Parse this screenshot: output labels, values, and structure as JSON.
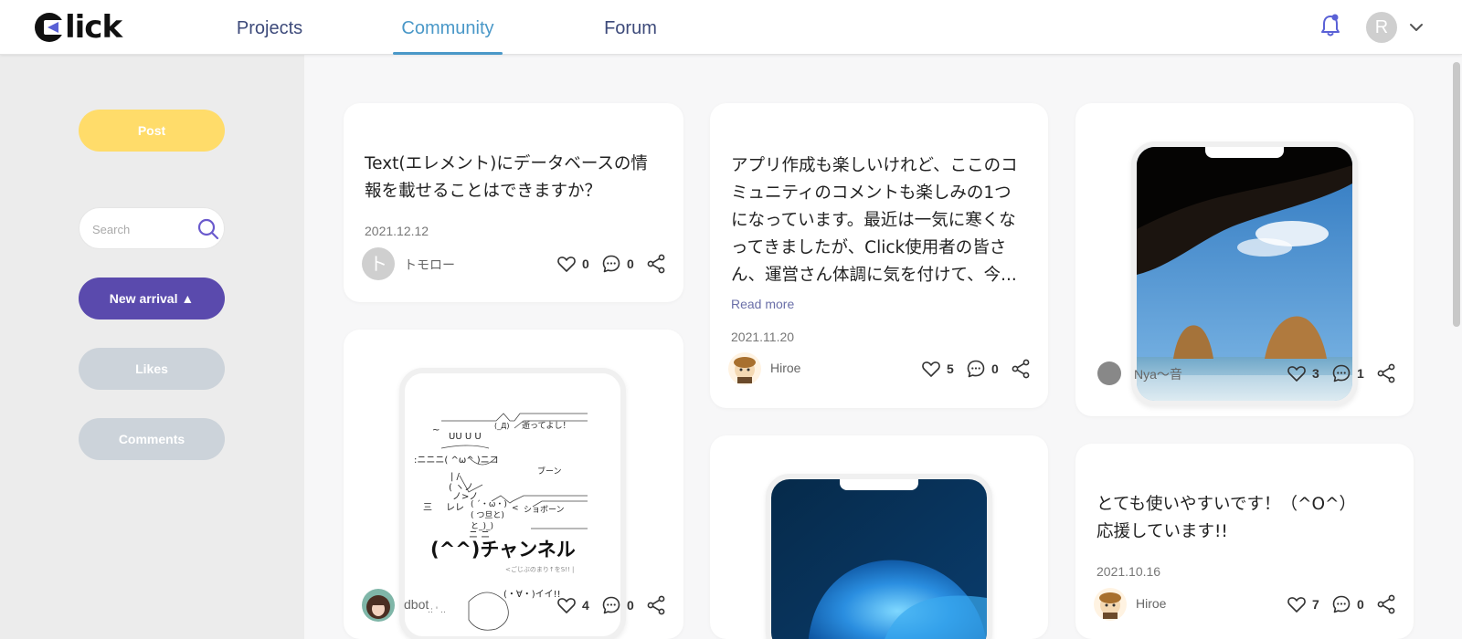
{
  "header": {
    "logo_text": "lick",
    "tabs": [
      {
        "label": "Projects"
      },
      {
        "label": "Community"
      },
      {
        "label": "Forum"
      }
    ],
    "avatar_initial": "R"
  },
  "sidebar": {
    "post_label": "Post",
    "search_placeholder": "Search",
    "new_arrival_label": "New arrival ▲",
    "likes_label": "Likes",
    "comments_label": "Comments"
  },
  "posts": [
    {
      "text_line1": "Text(エレメント)にデータベースの情",
      "text_line2": "報を載せることはできますか？",
      "date": "2021.12.12",
      "user": "トモロー",
      "avatar_initial": "ト",
      "likes": "0",
      "comments": "0"
    },
    {
      "image_title": "(^^)チャンネル",
      "user": "dbot",
      "likes": "4",
      "comments": "0"
    },
    {
      "text_line1": "アプリ作成も楽しいけれど、ここのコ",
      "text_line2": "ミュニティのコメントも楽しみの1つ",
      "text_line3": "になっています。最近は一気に寒くな",
      "text_line4": "ってきましたが、Click使用者の皆さ",
      "text_line5": "ん、運営さん体調に気を付けて、今...",
      "read_more": "Read more",
      "date": "2021.11.20",
      "user": "Hiroe",
      "likes": "5",
      "comments": "0"
    },
    {
      "user": "Nya～音",
      "likes": "3",
      "comments": "1"
    },
    {
      "text_line1": "とても使いやすいです！（^O^）",
      "text_line2": "応援しています!!",
      "date": "2021.10.16",
      "user": "Hiroe",
      "likes": "7",
      "comments": "0"
    }
  ],
  "colors": {
    "accent": "#4a98c8",
    "nav": "#3d4a7a",
    "post_button": "#ffdc6a",
    "new_arrival": "#5a4aad",
    "inactive_button": "#ccd3da"
  }
}
